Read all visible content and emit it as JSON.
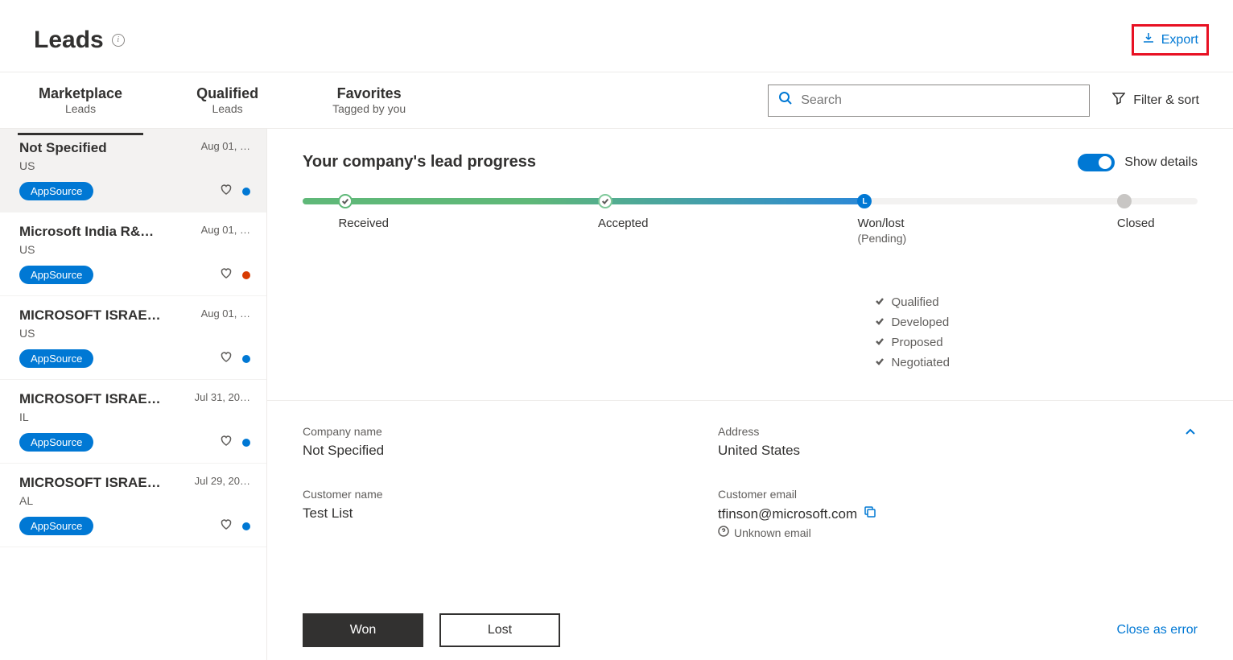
{
  "header": {
    "title": "Leads",
    "export_label": "Export"
  },
  "tabs": [
    {
      "label": "Marketplace",
      "sub": "Leads"
    },
    {
      "label": "Qualified",
      "sub": "Leads"
    },
    {
      "label": "Favorites",
      "sub": "Tagged by you"
    }
  ],
  "search": {
    "placeholder": "Search"
  },
  "filter_sort_label": "Filter & sort",
  "leads": [
    {
      "name": "Not Specified",
      "date": "Aug 01, …",
      "loc": "US",
      "badge": "AppSource",
      "dot": "blue"
    },
    {
      "name": "Microsoft India R&…",
      "date": "Aug 01, …",
      "loc": "US",
      "badge": "AppSource",
      "dot": "orange"
    },
    {
      "name": "MICROSOFT ISRAE…",
      "date": "Aug 01, …",
      "loc": "US",
      "badge": "AppSource",
      "dot": "blue"
    },
    {
      "name": "MICROSOFT ISRAE…",
      "date": "Jul 31, 20…",
      "loc": "IL",
      "badge": "AppSource",
      "dot": "blue"
    },
    {
      "name": "MICROSOFT ISRAE…",
      "date": "Jul 29, 20…",
      "loc": "AL",
      "badge": "AppSource",
      "dot": "blue"
    }
  ],
  "progress": {
    "title": "Your company's lead progress",
    "toggle_label": "Show details",
    "stages": {
      "received": "Received",
      "accepted": "Accepted",
      "wonlost": "Won/lost",
      "wonlost_sub": "(Pending)",
      "closed": "Closed"
    },
    "checklist": [
      "Qualified",
      "Developed",
      "Proposed",
      "Negotiated"
    ]
  },
  "detail": {
    "company_label": "Company name",
    "company_value": "Not Specified",
    "address_label": "Address",
    "address_value": "United States",
    "customer_label": "Customer name",
    "customer_value": "Test List",
    "email_label": "Customer email",
    "email_value": "tfinson@microsoft.com",
    "email_warn": "Unknown email"
  },
  "actions": {
    "won": "Won",
    "lost": "Lost",
    "close_error": "Close as error"
  }
}
